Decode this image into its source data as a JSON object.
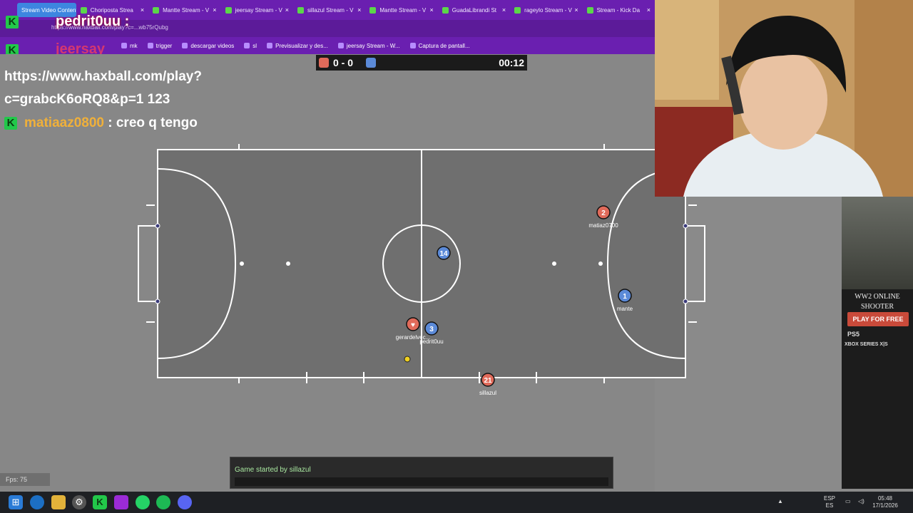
{
  "browser": {
    "tabs": [
      {
        "label": "Stream Video Content",
        "active": true
      },
      {
        "label": "Choriposta Strea"
      },
      {
        "label": "Mantte Stream - V"
      },
      {
        "label": "jeersay Stream - V"
      },
      {
        "label": "sillazul Stream - V"
      },
      {
        "label": "Mantte Stream - V"
      },
      {
        "label": "GuadaLibrandi St"
      },
      {
        "label": "rageylo Stream - V"
      },
      {
        "label": "Stream - Kick Da"
      }
    ],
    "address": "https://www.haxball.com/play?c=...wb75rQubg",
    "bookmarks": [
      "mk",
      "trigger",
      "descargar videos",
      "sl",
      "Previsualizar y des...",
      "jeersay Stream - W...",
      "Captura de pantall..."
    ],
    "close_glyph": "×"
  },
  "overlay": {
    "top_name": "pedrit0uu :",
    "second_name": "jeersay",
    "k_glyph": "K"
  },
  "scoreboard": {
    "score": "0 - 0",
    "time": "00:12",
    "red": "#e06a5a",
    "blue": "#5b8ad8"
  },
  "chat_overlay": {
    "url_line1": "https://www.haxball.com/play?",
    "url_line2": "c=grabcK6oRQ8&p=1 123",
    "user": "matiaaz0800",
    "message": ": creo q tengo"
  },
  "players": [
    {
      "number": "2",
      "name": "matiaz0700",
      "team": "red"
    },
    {
      "number": "14",
      "name": "",
      "team": "blue"
    },
    {
      "number": "1",
      "name": "mante",
      "team": "blue"
    },
    {
      "number": "3",
      "name": "pedrit0uu",
      "team": "blue"
    },
    {
      "number": "♥",
      "name": "gerardelvec...",
      "team": "red"
    },
    {
      "number": "21",
      "name": "sillazul",
      "team": "red"
    }
  ],
  "game_chat": {
    "message": "Game started by sillazul"
  },
  "fps": "Fps: 75",
  "ad": {
    "title_line1": "WW2 ONLINE",
    "title_line2": "SHOOTER",
    "button": "PLAY FOR FREE",
    "ps": "PS5",
    "xbox": "XBOX SERIES X|S"
  },
  "taskbar": {
    "lang1": "ESP",
    "lang2": "ES",
    "time": "05:48",
    "date": "17/1/2026"
  }
}
